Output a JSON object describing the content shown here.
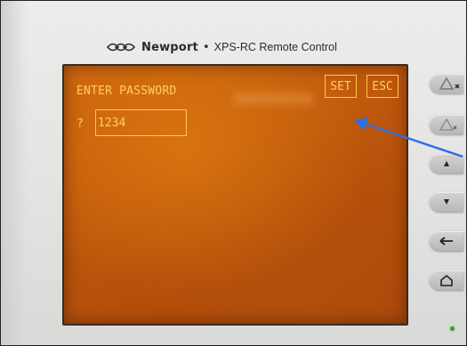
{
  "header": {
    "brand_name": "Newport",
    "separator": "•",
    "product_name": "XPS-RC Remote Control"
  },
  "screen": {
    "title": "ENTER PASSWORD",
    "prompt": "?",
    "password_value": "1234",
    "set_label": "SET",
    "esc_label": "ESC"
  },
  "side_buttons": [
    {
      "icon": "x-up-icon"
    },
    {
      "icon": "x-up-small-icon"
    },
    {
      "icon": "arrow-up-icon"
    },
    {
      "icon": "arrow-down-icon"
    },
    {
      "icon": "arrow-left-icon"
    },
    {
      "icon": "home-icon"
    }
  ],
  "colors": {
    "lcd_background": "#c0580c",
    "lcd_text": "#ffd15a",
    "pointer_arrow": "#2f6fe0",
    "status_led": "#3c9a2a"
  }
}
